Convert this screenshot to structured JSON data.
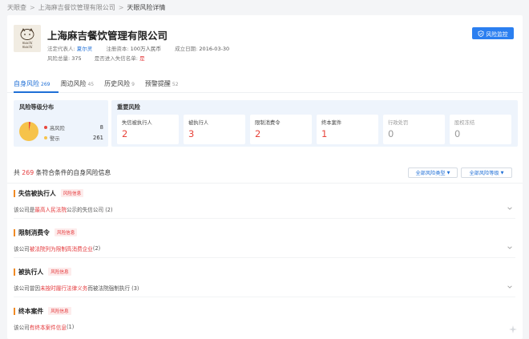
{
  "breadcrumb": {
    "root": "天眼查",
    "company": "上海麻吉餐饮管理有限公司",
    "current": "天眼风险详情"
  },
  "company": {
    "name": "上海麻吉餐饮管理有限公司",
    "logo_text_1": "machi",
    "logo_text_2": "machi",
    "legal_rep_label": "法定代表人:",
    "legal_rep": "夏尔灵",
    "capital_label": "注册资本:",
    "capital": "100万人民币",
    "founded_label": "成立日期:",
    "founded": "2016-03-30",
    "risk_total_label": "风险总量:",
    "risk_total": "375",
    "blacklist_label": "是否进入失信名单:",
    "blacklist": "是"
  },
  "monitor_button": "风险监控",
  "tabs": [
    {
      "label": "自身风险",
      "count": "269"
    },
    {
      "label": "周边风险",
      "count": "45"
    },
    {
      "label": "历史风险",
      "count": "9"
    },
    {
      "label": "预警提醒",
      "count": "52"
    }
  ],
  "distribution": {
    "title": "风险等级分布",
    "high_label": "高风险",
    "high_value": 8,
    "warn_label": "警示",
    "warn_value": 261,
    "high_color": "#e8453c",
    "warn_color": "#f6c34a"
  },
  "major": {
    "title": "重要风险",
    "cards": [
      {
        "label": "失信被执行人",
        "value": "2"
      },
      {
        "label": "被执行人",
        "value": "3"
      },
      {
        "label": "限制消费令",
        "value": "2"
      },
      {
        "label": "终本案件",
        "value": "1"
      },
      {
        "label": "行政处罚",
        "value": "0"
      },
      {
        "label": "股权冻结",
        "value": "0"
      }
    ]
  },
  "summary": {
    "prefix": "共",
    "count": "269",
    "suffix": "条符合条件的自身风险信息"
  },
  "filters": {
    "type": "全部风险类型",
    "level": "全部风险等级"
  },
  "sections": [
    {
      "title": "失信被执行人",
      "tag": "风险信息",
      "pre": "该公司是",
      "hl": "最高人民法院",
      "post": "公示的失信公司 (2)"
    },
    {
      "title": "限制消费令",
      "tag": "风险信息",
      "pre": "该公司",
      "hl": "被法院列为限制高消费企业",
      "post": " (2)"
    },
    {
      "title": "被执行人",
      "tag": "风险信息",
      "pre": "该公司曾因",
      "hl": "未按时履行法律义务",
      "post": "而被法院强制执行 (3)"
    },
    {
      "title": "终本案件",
      "tag": "风险信息",
      "pre": "该公司",
      "hl": "有终本案件信息",
      "post": " (1)"
    }
  ]
}
